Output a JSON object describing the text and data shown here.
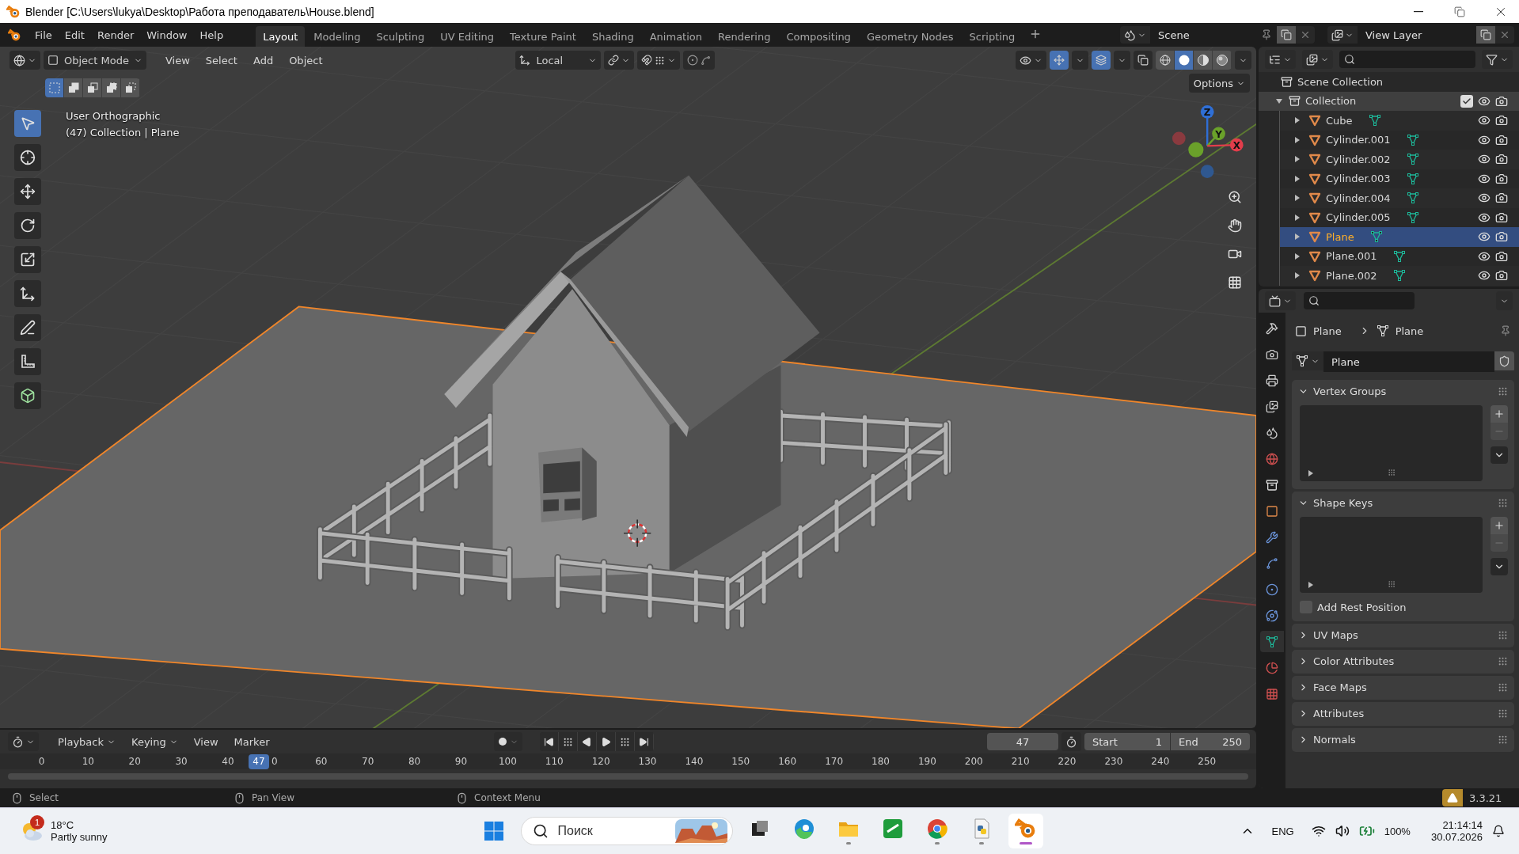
{
  "title_bar": {
    "title": "Blender [C:\\Users\\lukya\\Desktop\\Работа преподаватель\\House.blend]"
  },
  "menu": [
    "File",
    "Edit",
    "Render",
    "Window",
    "Help"
  ],
  "workspaces": [
    {
      "label": "Layout",
      "selected": true
    },
    {
      "label": "Modeling",
      "selected": false
    },
    {
      "label": "Sculpting",
      "selected": false
    },
    {
      "label": "UV Editing",
      "selected": false
    },
    {
      "label": "Texture Paint",
      "selected": false
    },
    {
      "label": "Shading",
      "selected": false
    },
    {
      "label": "Animation",
      "selected": false
    },
    {
      "label": "Rendering",
      "selected": false
    },
    {
      "label": "Compositing",
      "selected": false
    },
    {
      "label": "Geometry Nodes",
      "selected": false
    },
    {
      "label": "Scripting",
      "selected": false
    }
  ],
  "scene": "Scene",
  "view_layer": "View Layer",
  "viewport": {
    "mode": "Object Mode",
    "menus": [
      "View",
      "Select",
      "Add",
      "Object"
    ],
    "orientation": "Local",
    "select_modes": [
      {
        "selected": true
      },
      {
        "selected": false
      },
      {
        "selected": false
      },
      {
        "selected": false
      },
      {
        "selected": false
      }
    ],
    "gizmos_on": true,
    "overlays_on": true,
    "shading": [
      {
        "selected": false
      },
      {
        "selected": true
      },
      {
        "selected": false
      },
      {
        "selected": false
      }
    ],
    "options": "Options",
    "view_name": "User Orthographic",
    "context": "(47) Collection | Plane",
    "tools": [
      {
        "selected": true
      },
      {
        "selected": false
      },
      {
        "selected": false
      },
      {
        "selected": false
      },
      {
        "selected": false
      },
      {
        "selected": false
      },
      {
        "selected": false
      },
      {
        "selected": false
      },
      {
        "selected": false
      }
    ],
    "gizmo_axes": [
      "Z",
      "Y",
      "X"
    ]
  },
  "outliner": {
    "root": "Scene Collection",
    "collection": {
      "name": "Collection",
      "expanded": true,
      "checked": true,
      "children": [
        {
          "name": "Cube",
          "selected": false
        },
        {
          "name": "Cylinder.001",
          "selected": false
        },
        {
          "name": "Cylinder.002",
          "selected": false
        },
        {
          "name": "Cylinder.003",
          "selected": false
        },
        {
          "name": "Cylinder.004",
          "selected": false
        },
        {
          "name": "Cylinder.005",
          "selected": false
        },
        {
          "name": "Plane",
          "selected": true
        },
        {
          "name": "Plane.001",
          "selected": false
        },
        {
          "name": "Plane.002",
          "selected": false
        }
      ]
    }
  },
  "properties": {
    "tabs": [
      {
        "selected": false
      },
      {
        "selected": false
      },
      {
        "selected": false
      },
      {
        "selected": false
      },
      {
        "selected": false
      },
      {
        "selected": false
      },
      {
        "selected": false
      },
      {
        "selected": false
      },
      {
        "selected": false
      },
      {
        "selected": false
      },
      {
        "selected": false
      },
      {
        "selected": false
      },
      {
        "selected": true
      },
      {
        "selected": false
      },
      {
        "selected": false
      }
    ],
    "breadcrumb": [
      "Plane",
      "Plane"
    ],
    "datablock": "Plane",
    "panels": [
      {
        "title": "Vertex Groups",
        "expanded": true
      },
      {
        "title": "Shape Keys",
        "expanded": true,
        "option": {
          "label": "Add Rest Position",
          "checked": false
        }
      },
      {
        "title": "UV Maps",
        "expanded": false
      },
      {
        "title": "Color Attributes",
        "expanded": false
      },
      {
        "title": "Face Maps",
        "expanded": false
      },
      {
        "title": "Attributes",
        "expanded": false
      },
      {
        "title": "Normals",
        "expanded": false
      }
    ]
  },
  "timeline": {
    "menus": [
      {
        "label": "Playback",
        "dropdown": true
      },
      {
        "label": "Keying",
        "dropdown": true
      },
      {
        "label": "View",
        "dropdown": false
      },
      {
        "label": "Marker",
        "dropdown": false
      }
    ],
    "auto_keying": false,
    "current_frame": "47",
    "start_label": "Start",
    "start": "1",
    "end_label": "End",
    "end": "250",
    "ticks": [
      "0",
      "10",
      "20",
      "30",
      "40",
      "0",
      "60",
      "70",
      "80",
      "90",
      "100",
      "110",
      "120",
      "130",
      "140",
      "150",
      "160",
      "170",
      "180",
      "190",
      "200",
      "210",
      "220",
      "230",
      "240",
      "250"
    ],
    "playhead": {
      "label": "47",
      "level": 0.188
    }
  },
  "status_bar": {
    "hints": [
      "Select",
      "Pan View",
      "Context Menu"
    ],
    "version": "3.3.21"
  },
  "taskbar": {
    "weather": {
      "badge": "1",
      "temperature": "18°C",
      "condition": "Partly sunny"
    },
    "search_placeholder": "Поиск",
    "apps": [
      {
        "running": false,
        "active": false
      },
      {
        "running": false,
        "active": false
      },
      {
        "running": true,
        "active": false
      },
      {
        "running": false,
        "active": false
      },
      {
        "running": true,
        "active": false
      },
      {
        "running": true,
        "active": false
      },
      {
        "running": true,
        "active": true
      }
    ],
    "language": "ENG",
    "battery": "100%",
    "time": "21:14:14",
    "date": "30.07.2026"
  }
}
